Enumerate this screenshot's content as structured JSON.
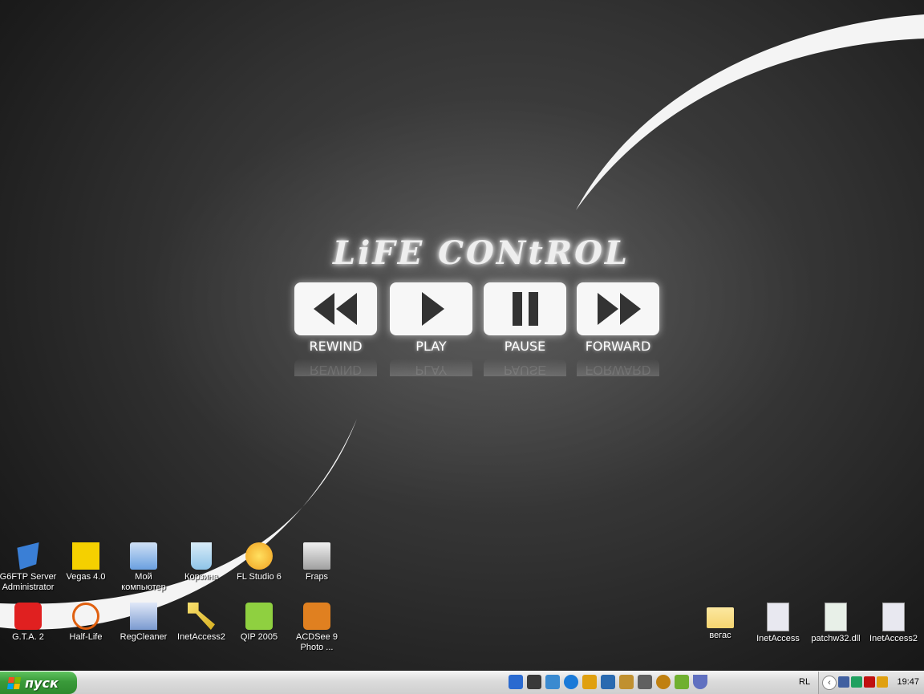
{
  "wallpaper": {
    "title": "LiFE CONtROL",
    "controls": [
      {
        "label": "REWIND",
        "icon": "rewind-icon"
      },
      {
        "label": "PLAY",
        "icon": "play-icon"
      },
      {
        "label": "PAUSE",
        "icon": "pause-icon"
      },
      {
        "label": "FORWARD",
        "icon": "forward-icon"
      }
    ]
  },
  "desktop_icons": [
    {
      "label": "G6FTP Server Administrator",
      "icon": "g6ftp-icon",
      "color": "#3a7fd6"
    },
    {
      "label": "Vegas 4.0",
      "icon": "vegas-icon",
      "color": "#f5d000"
    },
    {
      "label": "Мой компьютер",
      "icon": "my-computer-icon",
      "color": "#6aa0e0"
    },
    {
      "label": "Корзина",
      "icon": "recycle-bin-icon",
      "color": "#8fc4e8"
    },
    {
      "label": "FL Studio 6",
      "icon": "fl-studio-icon",
      "color": "#f0a020"
    },
    {
      "label": "Fraps",
      "icon": "fraps-icon",
      "color": "#d8d8d8"
    },
    {
      "label": "G.T.A. 2",
      "icon": "gta2-icon",
      "color": "#e02020"
    },
    {
      "label": "Half-Life",
      "icon": "half-life-icon",
      "color": "#e06010"
    },
    {
      "label": "RegCleaner",
      "icon": "regcleaner-icon",
      "color": "#7a9ad0"
    },
    {
      "label": "InetAccess2",
      "icon": "key-icon",
      "color": "#d8b020"
    },
    {
      "label": "QIP 2005",
      "icon": "qip-icon",
      "color": "#8fd040"
    },
    {
      "label": "ACDSee 9 Photo ...",
      "icon": "acdsee-icon",
      "color": "#e08020"
    },
    {
      "label": "вегас",
      "icon": "folder-icon",
      "color": "#f5d470"
    },
    {
      "label": "InetAccess",
      "icon": "settings-file-icon",
      "color": "#e8e8f0"
    },
    {
      "label": "patchw32.dll",
      "icon": "dll-file-icon",
      "color": "#e8f0e8"
    },
    {
      "label": "InetAccess2",
      "icon": "settings-file-icon",
      "color": "#e8e8f0"
    }
  ],
  "taskbar": {
    "start_label": "пуск",
    "quick_launch": [
      {
        "icon": "ie-icon",
        "color": "#2a6ad0"
      },
      {
        "icon": "counter-strike-icon",
        "color": "#3a3a3a"
      },
      {
        "icon": "msn-icon",
        "color": "#3a8ad0"
      },
      {
        "icon": "ie-browser-icon",
        "color": "#1a7ad8"
      },
      {
        "icon": "flash-icon",
        "color": "#e0a010"
      },
      {
        "icon": "outlook-icon",
        "color": "#2a6ab0"
      },
      {
        "icon": "winamp-icon",
        "color": "#c09030"
      },
      {
        "icon": "media-icon",
        "color": "#606060"
      },
      {
        "icon": "warcraft-icon",
        "color": "#c08010"
      },
      {
        "icon": "qip-icon",
        "color": "#70b030"
      },
      {
        "icon": "shield-icon",
        "color": "#6070c0"
      }
    ],
    "language": "RL",
    "tray_icons": [
      {
        "icon": "network-icon",
        "color": "#4060a0"
      },
      {
        "icon": "security-icon",
        "color": "#20a060"
      },
      {
        "icon": "ati-icon",
        "color": "#c01010"
      },
      {
        "icon": "shield-tray-icon",
        "color": "#e0a010"
      }
    ],
    "clock": "19:47"
  }
}
